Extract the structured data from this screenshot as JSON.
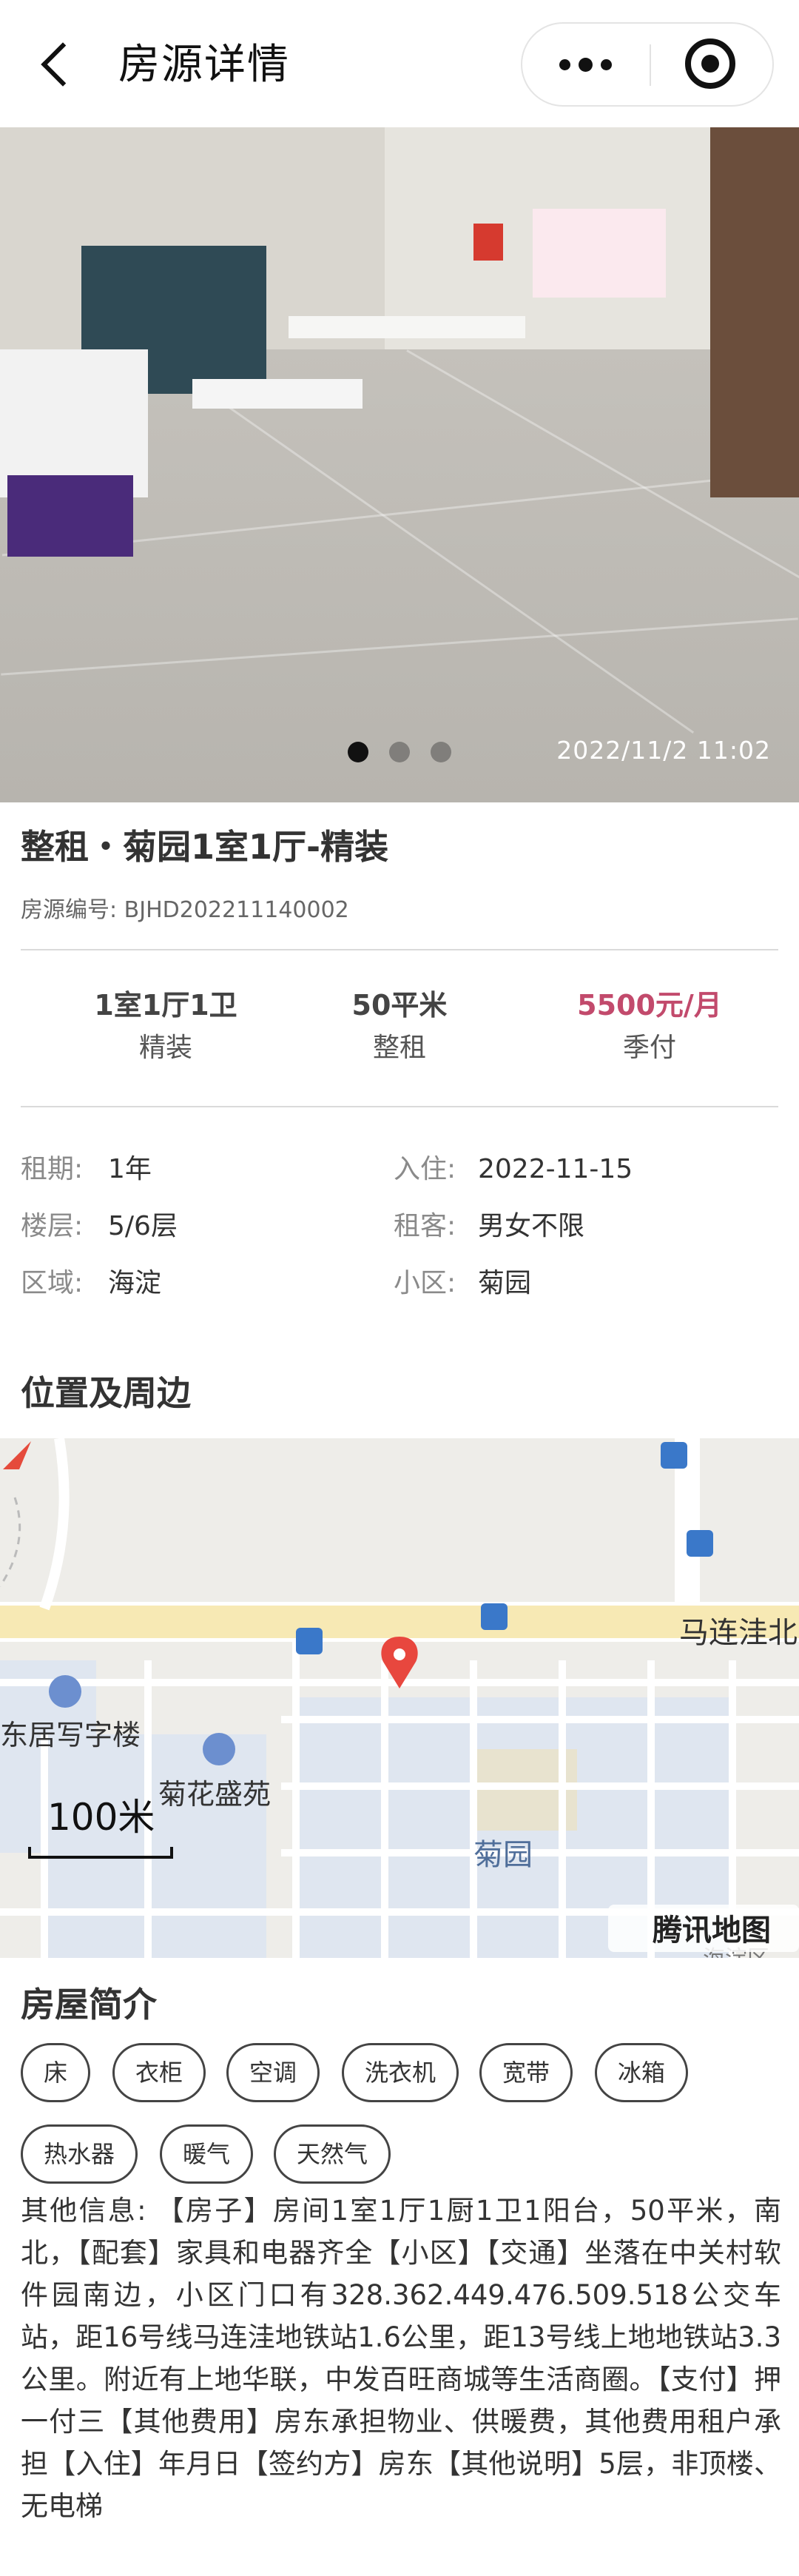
{
  "header": {
    "title": "房源详情"
  },
  "photo": {
    "timestamp": "2022/11/2  11:02",
    "slides_total": 3,
    "active_slide": 1
  },
  "listing": {
    "title": "整租・菊园1室1厅-精装",
    "code": "房源编号: BJHD202211140002"
  },
  "stats": [
    {
      "main": "1室1厅1卫",
      "sub": "精装"
    },
    {
      "main": "50平米",
      "sub": "整租"
    },
    {
      "main": "5500元/月",
      "sub": "季付"
    }
  ],
  "details": {
    "lease_label": "租期:",
    "lease_value": "1年",
    "movein_label": "入住:",
    "movein_value": "2022-11-15",
    "floor_label": "楼层:",
    "floor_value": "5/6层",
    "tenant_label": "租客:",
    "tenant_value": "男女不限",
    "district_label": "区域:",
    "district_value": "海淀",
    "community_label": "小区:",
    "community_value": "菊园"
  },
  "location": {
    "section_title": "位置及周边",
    "map_labels": {
      "road": "马连洼北",
      "office": "东居写字楼",
      "estate": "菊花盛苑",
      "community": "菊园",
      "district_corner": "海淀区"
    },
    "scale": "100米",
    "provider": "腾讯地图"
  },
  "intro": {
    "section_title": "房屋简介",
    "amenities": [
      "床",
      "衣柜",
      "空调",
      "洗衣机",
      "宽带",
      "冰箱",
      "热水器",
      "暖气",
      "天然气"
    ],
    "description": "其他信息: 【房子】房间1室1厅1厨1卫1阳台，50平米，南北，【配套】家具和电器齐全【小区】【交通】坐落在中关村软件园南边，小区门口有328.362.449.476.509.518公交车站，距16号线马连洼地铁站1.6公里，距13号线上地地铁站3.3公里。附近有上地华联，中发百旺商城等生活商圈。【支付】押一付三【其他费用】房东承担物业、供暖费，其他费用租户承担【入住】年月日【签约方】房东【其他说明】5层，非顶楼、无电梯"
  },
  "colors": {
    "price": "#c24a6c",
    "map_pin": "#e8473e",
    "map_block": "#dfe6f0"
  }
}
